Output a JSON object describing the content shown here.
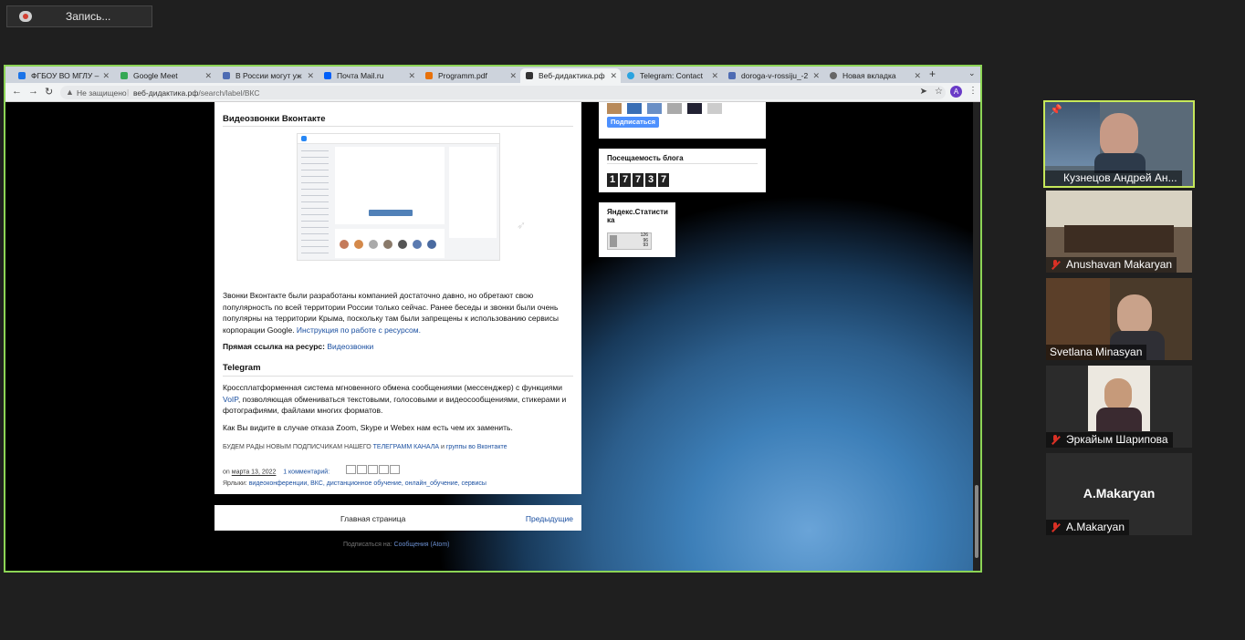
{
  "recording": {
    "label": "Запись..."
  },
  "browser": {
    "tabs": [
      {
        "title": "ФГБОУ ВО МГЛУ –",
        "color": "#1a73e8",
        "active": false
      },
      {
        "title": "Google Meet",
        "color": "#34a853",
        "active": false
      },
      {
        "title": "В России могут уж",
        "color": "#4d6bb3",
        "active": false
      },
      {
        "title": "Почта Mail.ru",
        "color": "#005ff9",
        "active": false
      },
      {
        "title": "Programm.pdf",
        "color": "#e8710a",
        "active": false
      },
      {
        "title": "Веб-дидактика.рф",
        "color": "#333333",
        "active": true
      },
      {
        "title": "Telegram: Contact",
        "color": "#2aa3e0",
        "active": false
      },
      {
        "title": "doroga-v-rossiju_-2",
        "color": "#4d6bb3",
        "active": false
      },
      {
        "title": "Новая вкладка",
        "color": "#666666",
        "active": false
      }
    ],
    "address": {
      "security_label": "Не защищено",
      "host": "веб-дидактика.рф",
      "path": "/search/label/ВКС"
    },
    "profile_initial": "A"
  },
  "post": {
    "heading1": "Видеозвонки Вконтакте",
    "p1": " Звонки Вконтакте были разработаны компанией достаточно давно, но обретают свою популярность по всей территории России только сейчас. Ранее беседы и звонки были очень популярны на территории Крыма, поскольку там были запрещены к использованию сервисы корпорации Google. ",
    "p1_link": "Инструкция по работе с ресурсом.",
    "direct_label": "Прямая ссылка на ресурс:",
    "direct_link": "Видеозвонки",
    "heading2": "Telegram",
    "p2_a": " Кроссплатформенная система мгновенного обмена сообщениями (мессенджер) с функциями ",
    "p2_voip": "VoIP",
    "p2_b": ", позволяющая обмениваться текстовыми, голосовыми и видеосообщениями, стикерами и фотографиями, файлами многих форматов.",
    "p3": "Как Вы видите в случае отказа Zoom, Skype и Webex  нам есть чем их заменить.",
    "p4_a": " БУДЕМ РАДЫ НОВЫМ ПОДПИСЧИКАМ НАШЕГО ",
    "p4_link1": "ТЕЛЕГРАММ КАНАЛА",
    "p4_mid": " и ",
    "p4_link2": "группы во Вконтакте",
    "meta_on": "on",
    "meta_date": "марта 13, 2022",
    "meta_comments": "1 комментарий:",
    "labels_title": "Ярлыки:",
    "labels": "видеоконференции, ВКС, дистанционное обучение, онлайн_обучение, сервисы"
  },
  "sidebar": {
    "subscribe": "Подписаться",
    "visits_title": "Посещаемость блога",
    "visits_digits": [
      "1",
      "7",
      "7",
      "3",
      "7"
    ],
    "yandex_title": "Яндекс.Статистика",
    "yandex_values": [
      "126",
      "96",
      "93"
    ]
  },
  "footer": {
    "home": "Главная страница",
    "prev": "Предыдущие",
    "subscribe_to": "Подписаться на:",
    "atom": "Сообщения (Atom)"
  },
  "participants": [
    {
      "name": "Кузнецов Андрей Ан...",
      "pinned": true,
      "muted": false
    },
    {
      "name": "Anushavan Makaryan",
      "pinned": false,
      "muted": true
    },
    {
      "name": "Svetlana Minasyan",
      "pinned": false,
      "muted": false
    },
    {
      "name": "Эркайым Шарипова",
      "pinned": false,
      "muted": true
    },
    {
      "name": "A.Makaryan",
      "pinned": false,
      "muted": true,
      "big_label": "A.Makaryan"
    }
  ],
  "colors": {
    "speaker_border": "#c6e85a",
    "share_border": "#8cd455",
    "link": "#1a4fa0"
  }
}
